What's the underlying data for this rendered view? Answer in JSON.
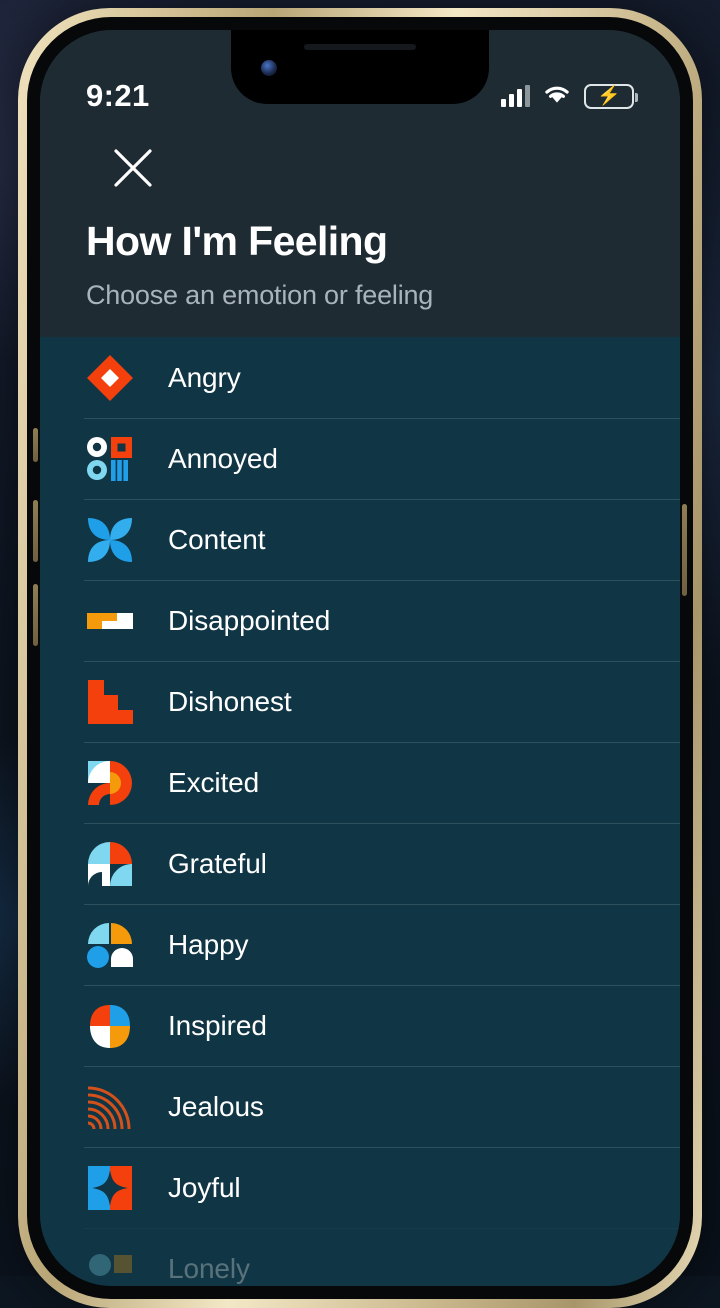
{
  "status_bar": {
    "time": "9:21",
    "signal_icon": "cellular-bars-icon",
    "wifi_icon": "wifi-icon",
    "battery_icon": "battery-charging-icon",
    "battery_charging": true,
    "battery_color": "#2fcc4a"
  },
  "header": {
    "close_icon": "close-x-icon",
    "title": "How I'm Feeling",
    "subtitle": "Choose an emotion or feeling",
    "background_color": "#1e2b33",
    "title_color": "#ffffff",
    "subtitle_color": "#a9b4ba"
  },
  "list": {
    "background_color": "#103544",
    "divider_color": "rgba(255,255,255,0.13)",
    "items": [
      {
        "label": "Angry",
        "icon": "angry-diamond-icon"
      },
      {
        "label": "Annoyed",
        "icon": "annoyed-grid-icon"
      },
      {
        "label": "Content",
        "icon": "content-petals-icon"
      },
      {
        "label": "Disappointed",
        "icon": "disappointed-blocks-icon"
      },
      {
        "label": "Dishonest",
        "icon": "dishonest-stairs-icon"
      },
      {
        "label": "Excited",
        "icon": "excited-arcs-icon"
      },
      {
        "label": "Grateful",
        "icon": "grateful-quarters-icon"
      },
      {
        "label": "Happy",
        "icon": "happy-shapes-icon"
      },
      {
        "label": "Inspired",
        "icon": "inspired-bud-icon"
      },
      {
        "label": "Jealous",
        "icon": "jealous-rings-icon"
      },
      {
        "label": "Joyful",
        "icon": "joyful-star-icon"
      },
      {
        "label": "Lonely",
        "icon": "lonely-icon"
      }
    ]
  },
  "palette": {
    "orange_red": "#f4400d",
    "orange": "#f59a0b",
    "blue": "#1f9fe8",
    "cyan": "#7fd8ef",
    "white": "#ffffff",
    "dark": "#103544"
  }
}
